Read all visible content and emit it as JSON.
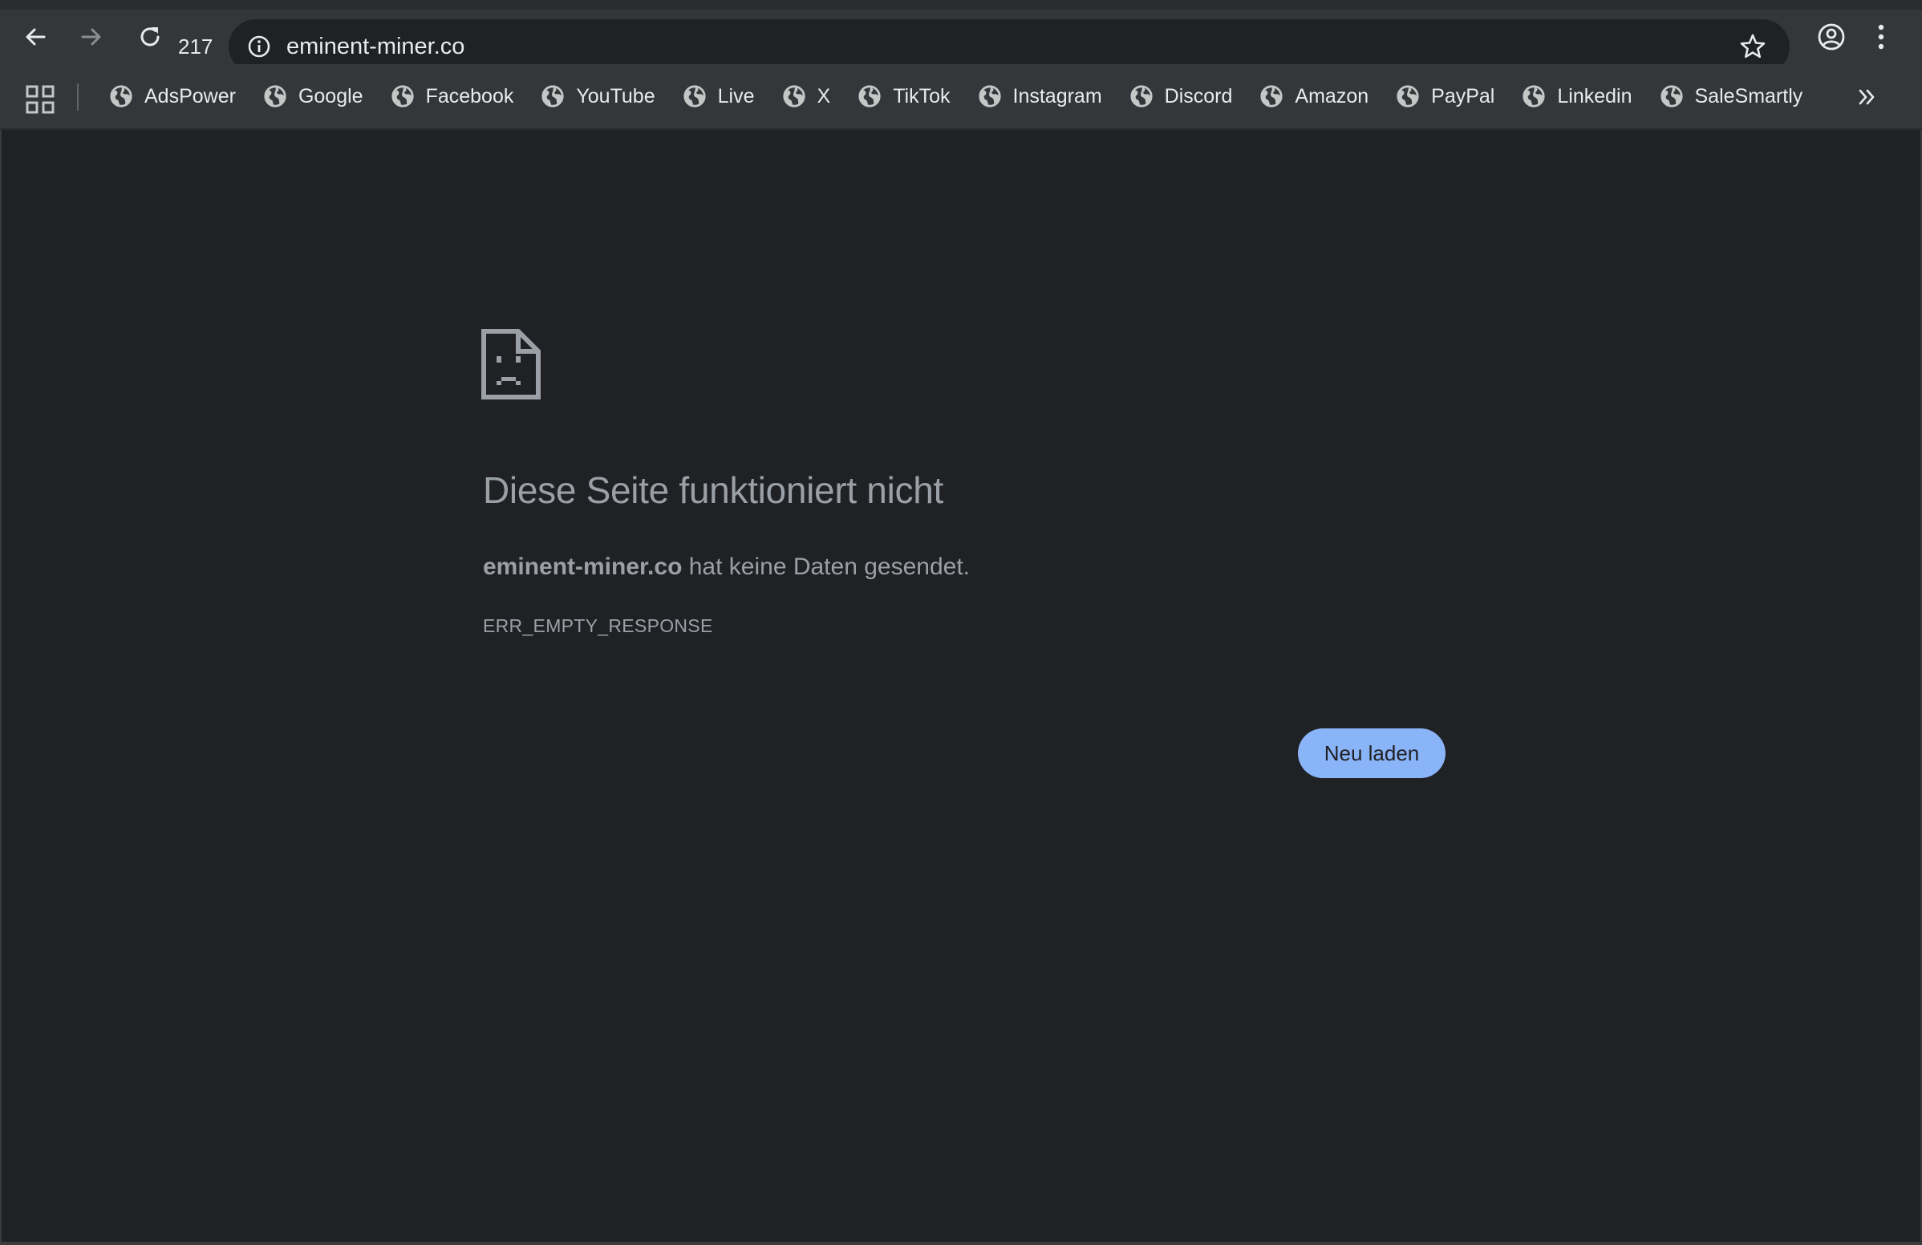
{
  "browser": {
    "toolbar": {
      "counter": "217",
      "url": "eminent-miner.co"
    },
    "bookmarks": [
      {
        "label": "AdsPower"
      },
      {
        "label": "Google"
      },
      {
        "label": "Facebook"
      },
      {
        "label": "YouTube"
      },
      {
        "label": "Live"
      },
      {
        "label": "X"
      },
      {
        "label": "TikTok"
      },
      {
        "label": "Instagram"
      },
      {
        "label": "Discord"
      },
      {
        "label": "Amazon"
      },
      {
        "label": "PayPal"
      },
      {
        "label": "Linkedin"
      },
      {
        "label": "SaleSmartly"
      }
    ]
  },
  "error_page": {
    "title": "Diese Seite funktioniert nicht",
    "host": "eminent-miner.co",
    "description_rest": " hat keine Daten gesendet.",
    "error_code": "ERR_EMPTY_RESPONSE",
    "reload_label": "Neu laden"
  },
  "colors": {
    "page_background": "#202124",
    "toolbar_background": "#35363a",
    "text_muted": "#9aa0a6",
    "accent_button": "#8ab4f8"
  },
  "icons": {
    "back": "arrow-left-icon",
    "forward": "arrow-right-icon",
    "reload": "reload-icon",
    "site_info": "info-icon",
    "bookmark_star": "star-icon",
    "profile": "profile-icon",
    "menu": "kebab-menu-icon",
    "apps": "apps-grid-icon",
    "bookmark_favicon": "globe-icon",
    "more_bookmarks": "chevron-double-right-icon",
    "error": "sad-document-icon"
  }
}
